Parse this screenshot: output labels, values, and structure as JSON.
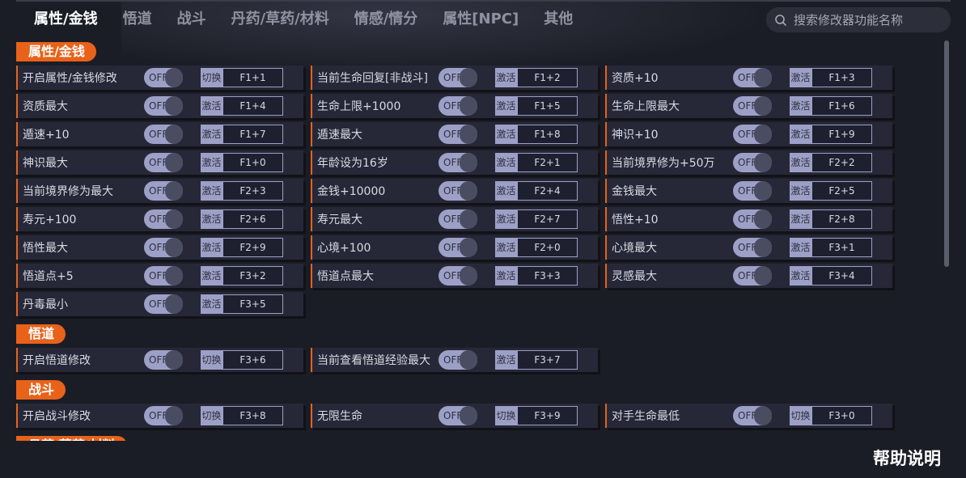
{
  "tabs": [
    "属性/金钱",
    "悟道",
    "战斗",
    "丹药/草药/材料",
    "情感/情分",
    "属性[NPC]",
    "其他"
  ],
  "search": {
    "placeholder": "搜索修改器功能名称"
  },
  "toggle_text": "OFF",
  "sections": [
    {
      "title": "属性/金钱",
      "items": [
        {
          "label": "开启属性/金钱修改",
          "mode": "切换",
          "key": "F1+1"
        },
        {
          "label": "当前生命回复[非战斗]",
          "mode": "激活",
          "key": "F1+2"
        },
        {
          "label": "资质+10",
          "mode": "激活",
          "key": "F1+3"
        },
        {
          "label": "资质最大",
          "mode": "激活",
          "key": "F1+4"
        },
        {
          "label": "生命上限+1000",
          "mode": "激活",
          "key": "F1+5"
        },
        {
          "label": "生命上限最大",
          "mode": "激活",
          "key": "F1+6"
        },
        {
          "label": "遁速+10",
          "mode": "激活",
          "key": "F1+7"
        },
        {
          "label": "遁速最大",
          "mode": "激活",
          "key": "F1+8"
        },
        {
          "label": "神识+10",
          "mode": "激活",
          "key": "F1+9"
        },
        {
          "label": "神识最大",
          "mode": "激活",
          "key": "F1+0"
        },
        {
          "label": "年龄设为16岁",
          "mode": "激活",
          "key": "F2+1"
        },
        {
          "label": "当前境界修为+50万",
          "mode": "激活",
          "key": "F2+2"
        },
        {
          "label": "当前境界修为最大",
          "mode": "激活",
          "key": "F2+3"
        },
        {
          "label": "金钱+10000",
          "mode": "激活",
          "key": "F2+4"
        },
        {
          "label": "金钱最大",
          "mode": "激活",
          "key": "F2+5"
        },
        {
          "label": "寿元+100",
          "mode": "激活",
          "key": "F2+6"
        },
        {
          "label": "寿元最大",
          "mode": "激活",
          "key": "F2+7"
        },
        {
          "label": "悟性+10",
          "mode": "激活",
          "key": "F2+8"
        },
        {
          "label": "悟性最大",
          "mode": "激活",
          "key": "F2+9"
        },
        {
          "label": "心境+100",
          "mode": "激活",
          "key": "F2+0"
        },
        {
          "label": "心境最大",
          "mode": "激活",
          "key": "F3+1"
        },
        {
          "label": "悟道点+5",
          "mode": "激活",
          "key": "F3+2"
        },
        {
          "label": "悟道点最大",
          "mode": "激活",
          "key": "F3+3"
        },
        {
          "label": "灵感最大",
          "mode": "激活",
          "key": "F3+4"
        },
        {
          "label": "丹毒最小",
          "mode": "激活",
          "key": "F3+5"
        }
      ]
    },
    {
      "title": "悟道",
      "items": [
        {
          "label": "开启悟道修改",
          "mode": "切换",
          "key": "F3+6"
        },
        {
          "label": "当前查看悟道经验最大",
          "mode": "激活",
          "key": "F3+7"
        }
      ]
    },
    {
      "title": "战斗",
      "items": [
        {
          "label": "开启战斗修改",
          "mode": "切换",
          "key": "F3+8"
        },
        {
          "label": "无限生命",
          "mode": "切换",
          "key": "F3+9"
        },
        {
          "label": "对手生命最低",
          "mode": "切换",
          "key": "F3+0"
        }
      ]
    },
    {
      "title": "丹药/草药/材料",
      "items": []
    }
  ],
  "help": "帮助说明"
}
